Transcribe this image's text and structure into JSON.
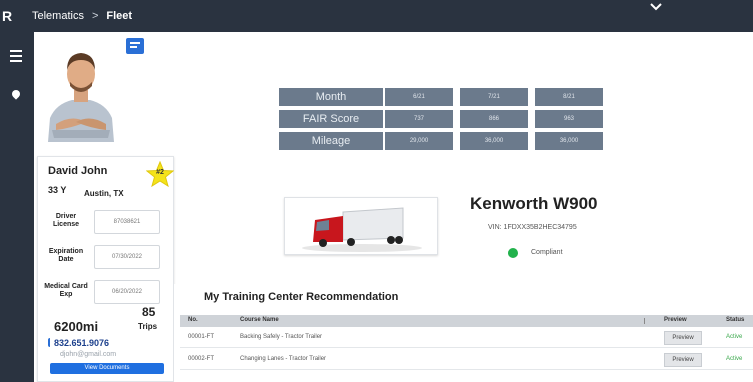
{
  "breadcrumb": {
    "root": "Telematics",
    "separator": ">",
    "current": "Fleet"
  },
  "driver": {
    "name": "David John",
    "age": "33 Y",
    "location": "Austin, TX",
    "rank": "#2",
    "fields": [
      {
        "label": "Driver License",
        "value": "87038621"
      },
      {
        "label": "Expiration Date",
        "value": "07/30/2022"
      },
      {
        "label": "Medical Card Exp",
        "value": "06/20/2022"
      }
    ],
    "miles": "6200mi",
    "trips_count": "85",
    "trips_label": "Trips",
    "phone": "832.651.9076",
    "email": "djohn@gmail.com",
    "documents_button": "View Documents"
  },
  "kpi": {
    "rows": [
      {
        "label": "Month",
        "values": [
          "6/21",
          "7/21",
          "8/21"
        ]
      },
      {
        "label": "FAIR Score",
        "values": [
          "737",
          "866",
          "963"
        ]
      },
      {
        "label": "Mileage",
        "values": [
          "29,000",
          "36,000",
          "36,000"
        ]
      }
    ]
  },
  "vehicle": {
    "name": "Kenworth W900",
    "vin": "VIN: 1FDXX35B2HEC34795",
    "status": "Compliant",
    "status_color": "#22b24c"
  },
  "training": {
    "title": "My Training Center Recommendation",
    "columns": [
      "No.",
      "Course Name",
      "Preview",
      "Status"
    ],
    "rows": [
      {
        "no": "00001-FT",
        "name": "Backing Safely - Tractor Trailer",
        "preview": "Preview",
        "status": "Active"
      },
      {
        "no": "00002-FT",
        "name": "Changing Lanes - Tractor Trailer",
        "preview": "Preview",
        "status": "Active"
      }
    ]
  },
  "colors": {
    "topbar": "#2a3340",
    "kpi_cell": "#6b7a8c",
    "accent": "#1f6fe0"
  }
}
